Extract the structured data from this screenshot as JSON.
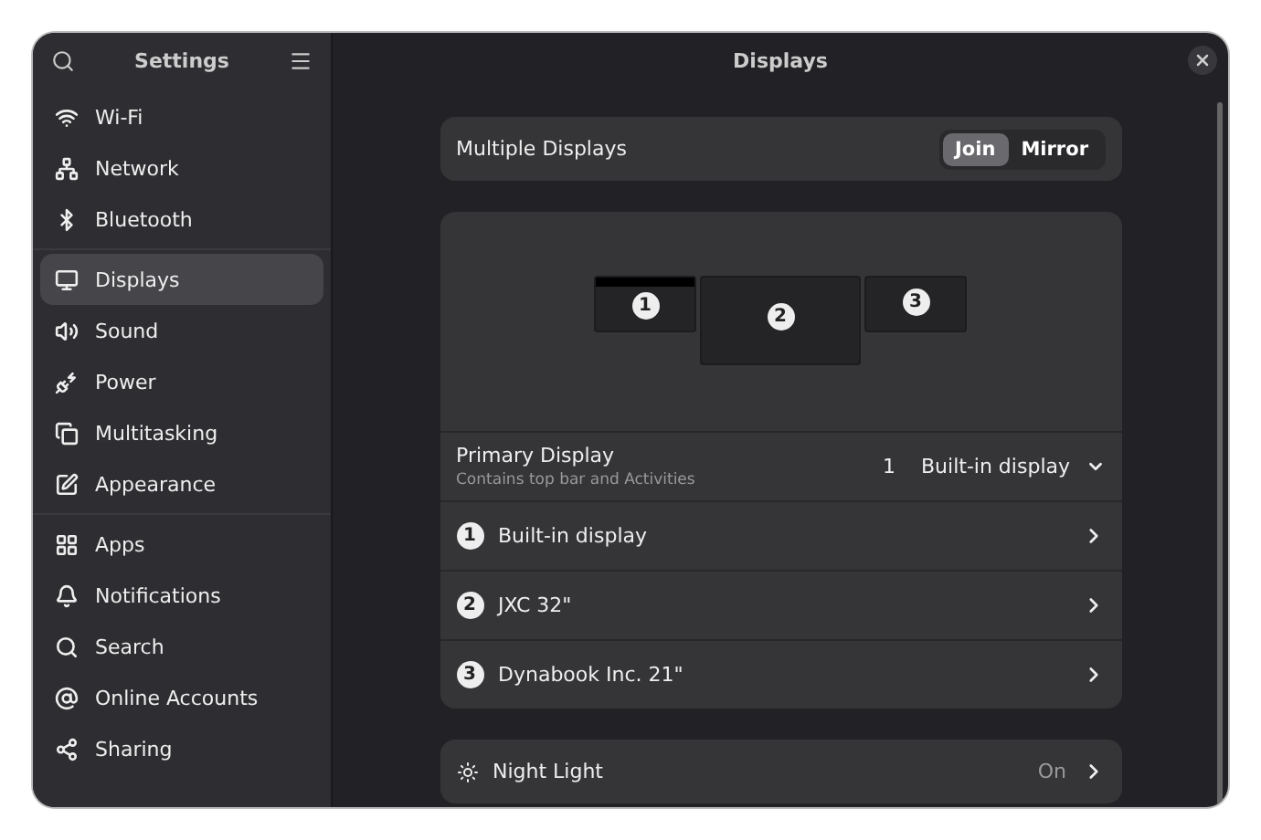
{
  "sidebar": {
    "title": "Settings",
    "groups": [
      [
        {
          "label": "Wi-Fi",
          "selected": false
        },
        {
          "label": "Network",
          "selected": false
        },
        {
          "label": "Bluetooth",
          "selected": false
        }
      ],
      [
        {
          "label": "Displays",
          "selected": true
        },
        {
          "label": "Sound",
          "selected": false
        },
        {
          "label": "Power",
          "selected": false
        },
        {
          "label": "Multitasking",
          "selected": false
        },
        {
          "label": "Appearance",
          "selected": false
        }
      ],
      [
        {
          "label": "Apps",
          "selected": false
        },
        {
          "label": "Notifications",
          "selected": false
        },
        {
          "label": "Search",
          "selected": false
        },
        {
          "label": "Online Accounts",
          "selected": false
        },
        {
          "label": "Sharing",
          "selected": false
        }
      ]
    ]
  },
  "main": {
    "title": "Displays",
    "multiple_displays": {
      "label": "Multiple Displays",
      "options": [
        {
          "label": "Join",
          "selected": true
        },
        {
          "label": "Mirror",
          "selected": false
        }
      ]
    },
    "arrangement": [
      {
        "number": "1",
        "top_bar": true
      },
      {
        "number": "2",
        "top_bar": false
      },
      {
        "number": "3",
        "top_bar": false
      }
    ],
    "primary_display": {
      "title": "Primary Display",
      "subtitle": "Contains top bar and Activities",
      "number": "1",
      "value": "Built-in display"
    },
    "displays": [
      {
        "number": "1",
        "name": "Built-in display"
      },
      {
        "number": "2",
        "name": "JXC 32\""
      },
      {
        "number": "3",
        "name": "Dynabook Inc. 21\""
      }
    ],
    "night_light": {
      "label": "Night Light",
      "value": "On"
    }
  }
}
